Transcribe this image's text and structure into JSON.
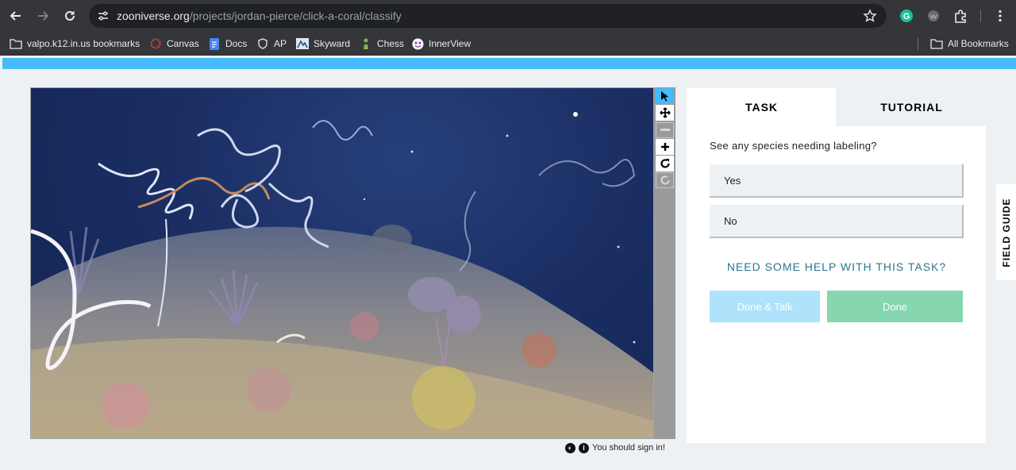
{
  "browser": {
    "url_host": "zooniverse.org",
    "url_path": "/projects/jordan-pierce/click-a-coral/classify",
    "bookmarks": [
      {
        "label": "valpo.k12.in.us bookmarks",
        "icon": "folder-icon"
      },
      {
        "label": "Canvas",
        "icon": "canvas-icon"
      },
      {
        "label": "Docs",
        "icon": "docs-icon"
      },
      {
        "label": "AP",
        "icon": "ap-icon"
      },
      {
        "label": "Skyward",
        "icon": "skyward-icon"
      },
      {
        "label": "Chess",
        "icon": "chess-icon"
      },
      {
        "label": "InnerView",
        "icon": "innerview-icon"
      }
    ],
    "all_bookmarks": "All Bookmarks"
  },
  "viewer": {
    "sign_in_text": "You should sign in!",
    "tools": [
      "pointer",
      "move",
      "zoom-out",
      "zoom-in",
      "rotate",
      "reset"
    ]
  },
  "task_panel": {
    "tabs": [
      "TASK",
      "TUTORIAL"
    ],
    "question": "See any species needing labeling?",
    "answers": [
      "Yes",
      "No"
    ],
    "help_link": "NEED SOME HELP WITH THIS TASK?",
    "done_talk": "Done & Talk",
    "done": "Done"
  },
  "field_guide": "FIELD GUIDE",
  "colors": {
    "accent_blue": "#43bbfd",
    "done_green": "#86d6b0",
    "talk_blue": "#aee3fb",
    "help_teal": "#2d7490"
  }
}
